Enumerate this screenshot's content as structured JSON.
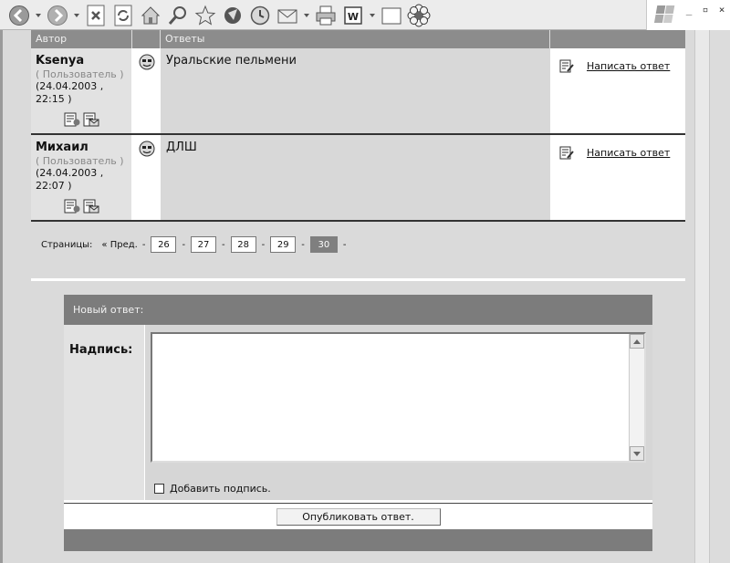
{
  "browser": {
    "toolbar_icons": [
      "back-icon",
      "forward-icon",
      "stop-icon",
      "refresh-icon",
      "home-icon",
      "search-icon",
      "favorites-icon",
      "media-icon",
      "history-icon",
      "mail-icon",
      "print-icon",
      "word-icon",
      "blank-icon",
      "flower-icon"
    ],
    "window_controls": [
      "_",
      "▫",
      "×"
    ]
  },
  "table": {
    "headers": {
      "author": "Автор",
      "icon": "",
      "replies": "Ответы",
      "action": ""
    },
    "rows": [
      {
        "name": "Ksenya",
        "role": "( Пользователь )",
        "date_line1": "(24.04.2003 ,",
        "date_line2": "22:15 )",
        "message": "Уральские пельмени",
        "reply_label": "Написать ответ"
      },
      {
        "name": "Михаил",
        "role": "( Пользователь )",
        "date_line1": "(24.04.2003 ,",
        "date_line2": "22:07 )",
        "message": "ДЛШ",
        "reply_label": "Написать ответ"
      }
    ]
  },
  "pager": {
    "label": "Страницы:",
    "prev": "« Пред.",
    "pages": [
      "26",
      "27",
      "28",
      "29",
      "30"
    ],
    "current": "30"
  },
  "form": {
    "title": "Новый ответ:",
    "field_label": "Надпись:",
    "textarea_value": "",
    "signature_label": "Добавить подпись.",
    "signature_checked": false,
    "submit_label": "Опубликовать ответ."
  }
}
